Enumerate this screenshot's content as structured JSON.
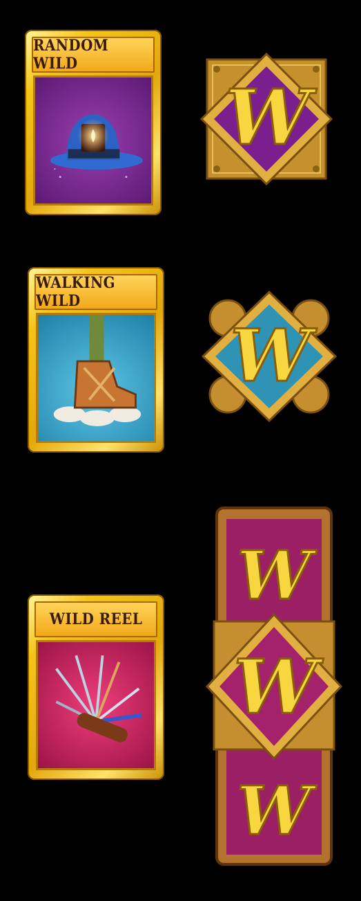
{
  "features": [
    {
      "id": "random-wild",
      "label": "RANDOM WILD"
    },
    {
      "id": "walking-wild",
      "label": "WALKING WILD"
    },
    {
      "id": "wild-reel",
      "label": "WILD REEL"
    }
  ],
  "wild_letter": "W",
  "icons": {
    "card1": "top-hat-with-candle-icon",
    "card2": "walking-boot-icon",
    "card3": "multi-tool-knife-icon",
    "symbol1": "purple-w-wild-symbol",
    "symbol2": "blue-w-wild-symbol",
    "symbol3": "stacked-w-wild-reel"
  },
  "colors": {
    "gold": "#f2c21c",
    "purple": "#7b1f8e",
    "blue": "#2f93b5",
    "magenta": "#c0215f",
    "wood": "#b3722d"
  }
}
